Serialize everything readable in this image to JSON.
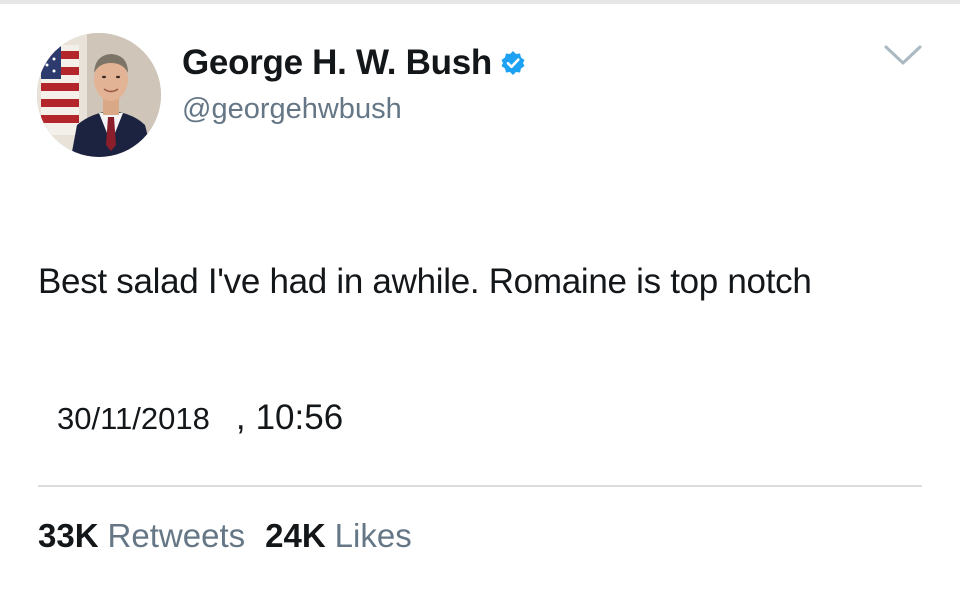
{
  "tweet": {
    "author": {
      "display_name": "George H. W. Bush",
      "handle": "@georgehwbush",
      "verified": true
    },
    "text": "Best salad I've had in awhile.  Romaine is top notch",
    "timestamp": {
      "date": "30/11/2018",
      "separator": ",",
      "time": "10:56"
    },
    "stats": {
      "retweets_count": "33K",
      "retweets_label": "Retweets",
      "likes_count": "24K",
      "likes_label": "Likes"
    }
  },
  "icons": {
    "verified": "verified-badge-icon",
    "menu": "chevron-down-icon"
  },
  "colors": {
    "verified_blue": "#1da1f2",
    "secondary_text": "#657786",
    "primary_text": "#14171a",
    "divider": "#dcdcdc"
  }
}
